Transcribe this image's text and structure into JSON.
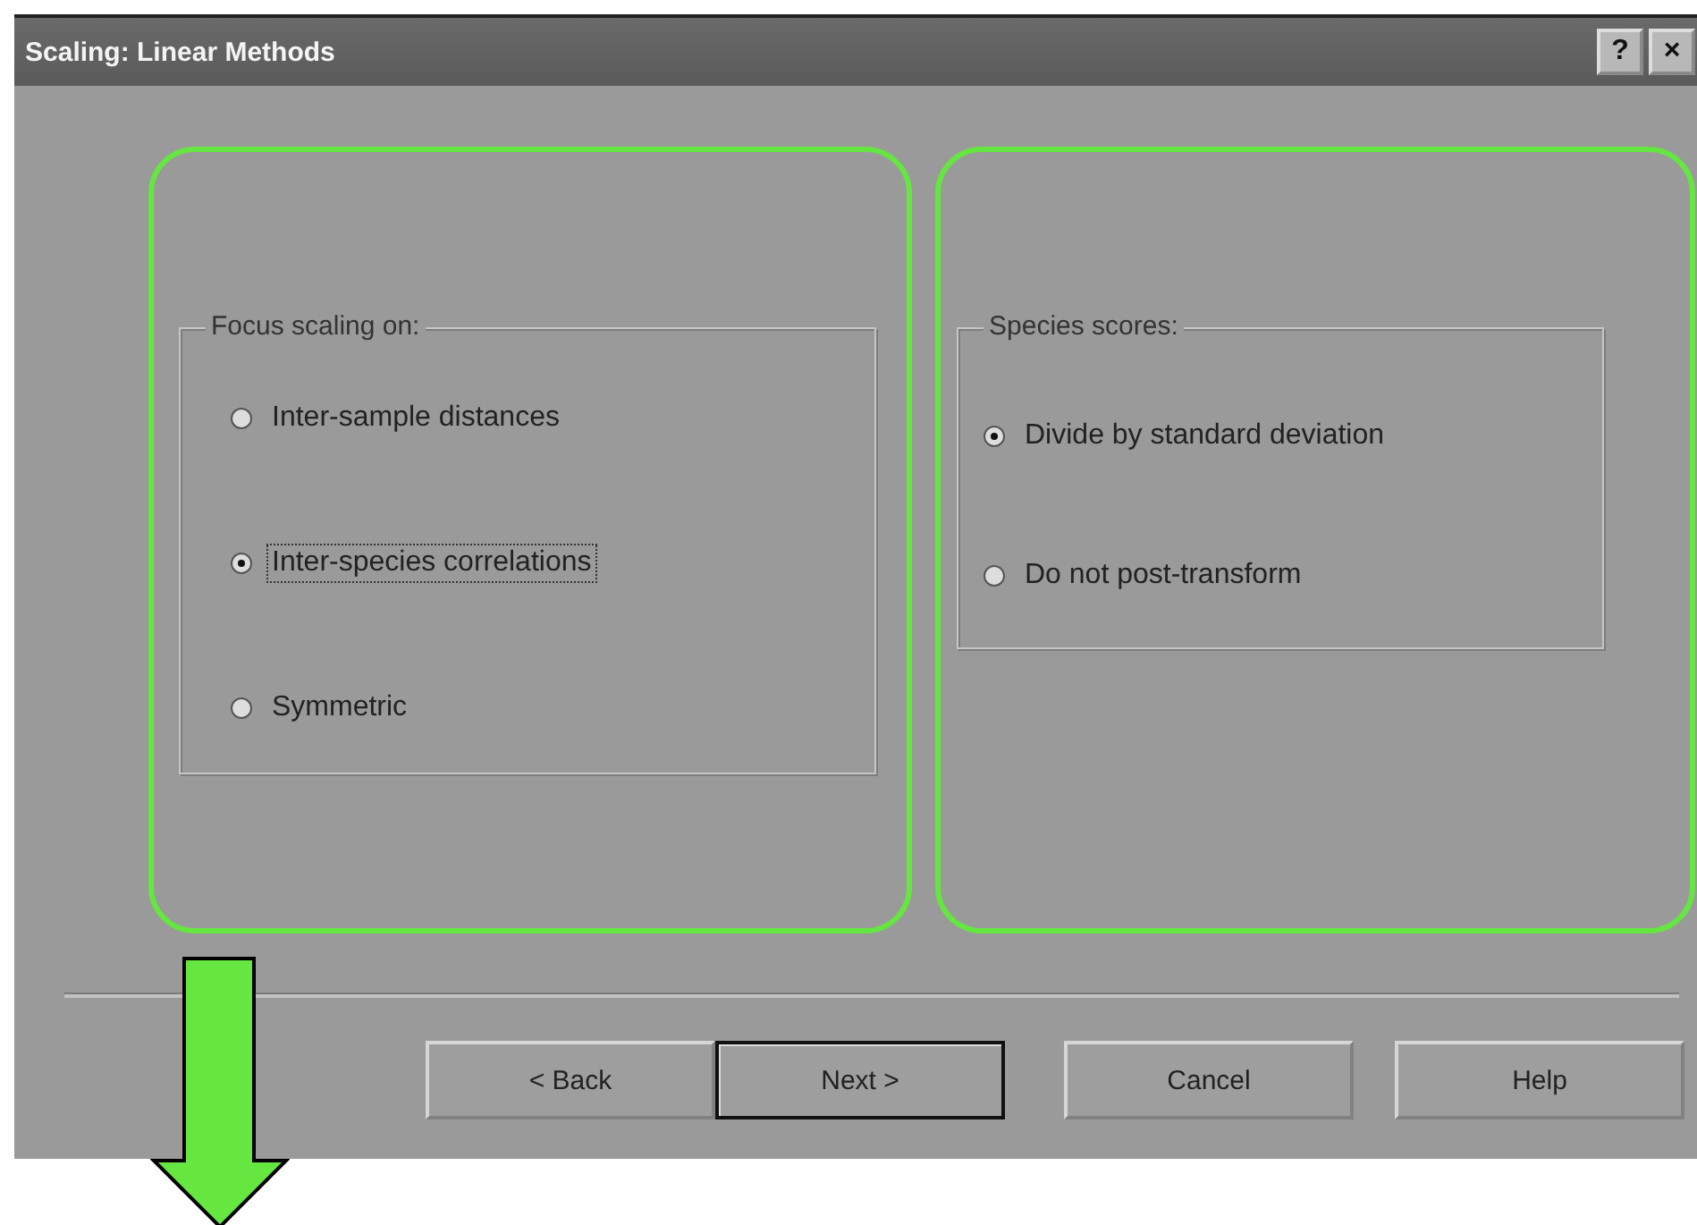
{
  "window": {
    "title": "Scaling: Linear Methods",
    "title_buttons": [
      "?",
      "×"
    ]
  },
  "groups": [
    {
      "label": "Focus scaling on:",
      "options": [
        {
          "label": "Inter-sample distances",
          "selected": false,
          "focused": false
        },
        {
          "label": "Inter-species correlations",
          "selected": true,
          "focused": true
        },
        {
          "label": "Symmetric",
          "selected": false,
          "focused": false
        }
      ]
    },
    {
      "label": "Species scores:",
      "options": [
        {
          "label": "Divide by standard deviation",
          "selected": true,
          "focused": false
        },
        {
          "label": "Do not post-transform",
          "selected": false,
          "focused": false
        }
      ]
    }
  ],
  "buttons": [
    {
      "label": "< Back",
      "default": false
    },
    {
      "label": "Next >",
      "default": true
    },
    {
      "label": "Cancel",
      "default": false
    },
    {
      "label": "Help",
      "default": false
    }
  ]
}
